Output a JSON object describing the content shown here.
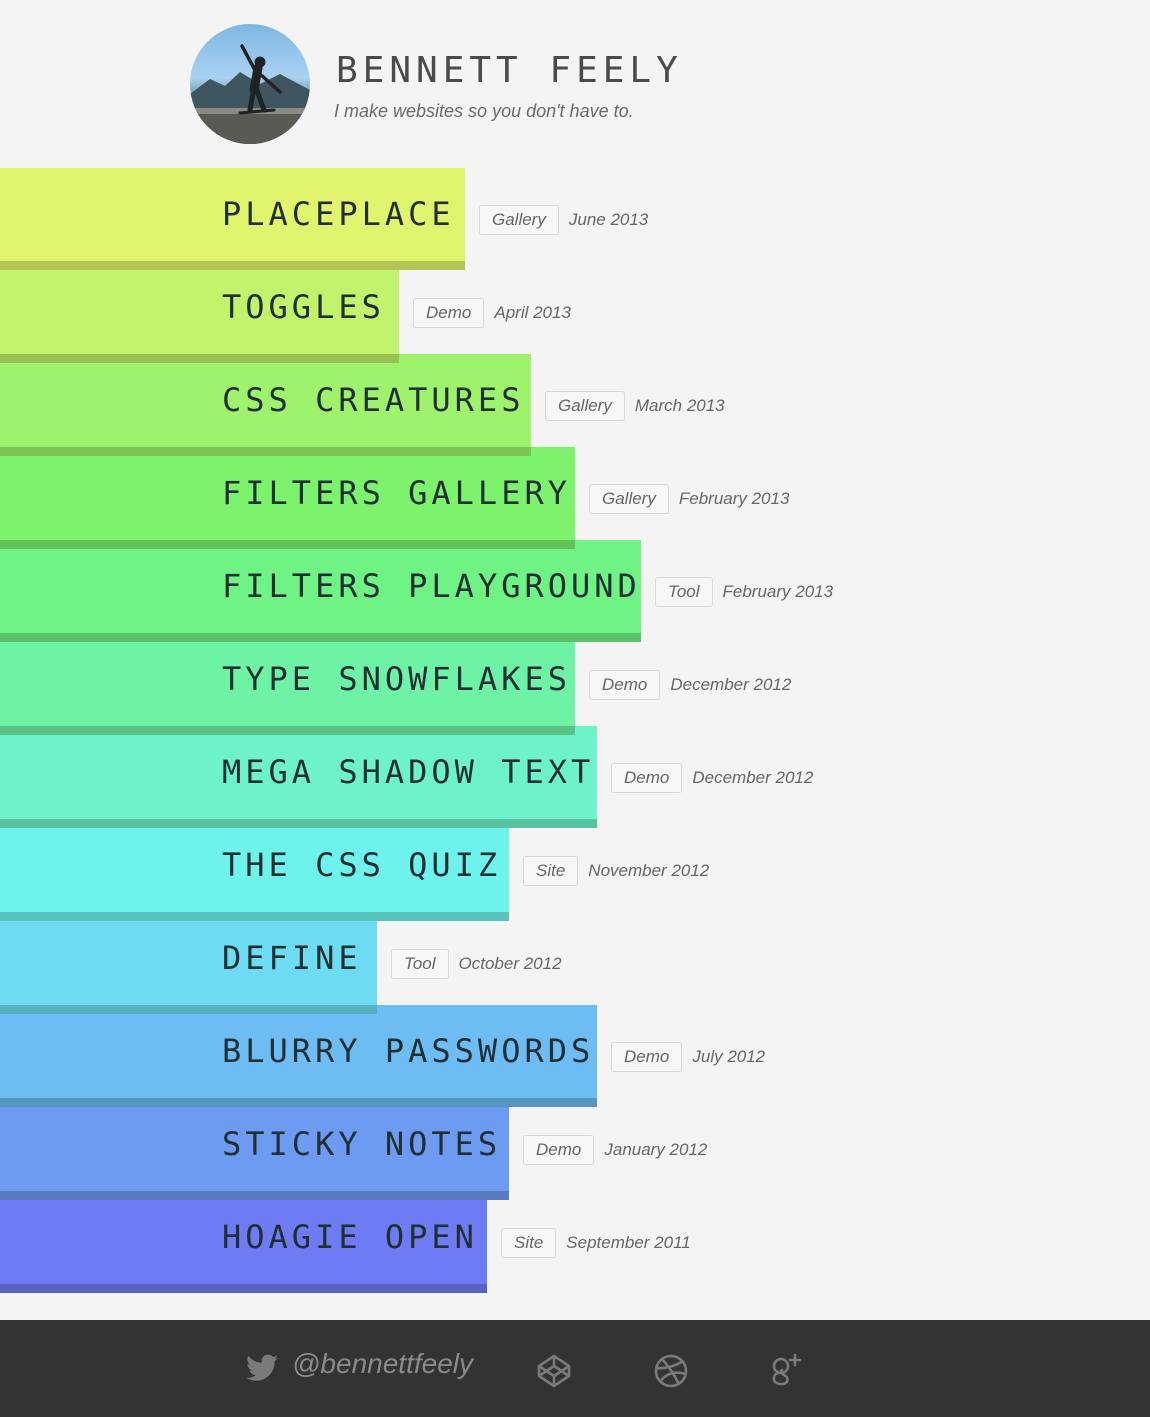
{
  "header": {
    "name": "BENNETT FEELY",
    "tagline": "I make websites so you don't have to."
  },
  "projects": [
    {
      "title": "PLACEPLACE",
      "tag": "Gallery",
      "date": "June 2013",
      "color": "#e0f46d",
      "shadow": "#b3c655"
    },
    {
      "title": "TOGGLES",
      "tag": "Demo",
      "date": "April 2013",
      "color": "#c3f26d",
      "shadow": "#9cc256"
    },
    {
      "title": "CSS CREATURES",
      "tag": "Gallery",
      "date": "March 2013",
      "color": "#9ff26b",
      "shadow": "#7fc256"
    },
    {
      "title": "FILTERS GALLERY",
      "tag": "Gallery",
      "date": "February 2013",
      "color": "#7cf26d",
      "shadow": "#63c257"
    },
    {
      "title": "FILTERS PLAYGROUND",
      "tag": "Tool",
      "date": "February 2013",
      "color": "#70f385",
      "shadow": "#5ac26a"
    },
    {
      "title": "TYPE SNOWFLAKES",
      "tag": "Demo",
      "date": "December 2012",
      "color": "#6ef2a6",
      "shadow": "#58c285"
    },
    {
      "title": "MEGA SHADOW TEXT",
      "tag": "Demo",
      "date": "December 2012",
      "color": "#6ef2ca",
      "shadow": "#58c2a1"
    },
    {
      "title": "THE CSS QUIZ",
      "tag": "Site",
      "date": "November 2012",
      "color": "#6ef2ec",
      "shadow": "#58c2bd"
    },
    {
      "title": "DEFINE",
      "tag": "Tool",
      "date": "October 2012",
      "color": "#6ddcf2",
      "shadow": "#57b0c2"
    },
    {
      "title": "BLURRY PASSWORDS",
      "tag": "Demo",
      "date": "July 2012",
      "color": "#6dbcf4",
      "shadow": "#5796c3"
    },
    {
      "title": "STICKY NOTES",
      "tag": "Demo",
      "date": "January 2012",
      "color": "#6e9bf2",
      "shadow": "#587cc2"
    },
    {
      "title": "HOAGIE OPEN",
      "tag": "Site",
      "date": "September 2011",
      "color": "#6e7bf2",
      "shadow": "#5862c2"
    }
  ],
  "footer": {
    "handle": "@bennettfeely",
    "icons": [
      "twitter-icon",
      "codepen-icon",
      "dribbble-icon",
      "google-plus-icon"
    ]
  }
}
